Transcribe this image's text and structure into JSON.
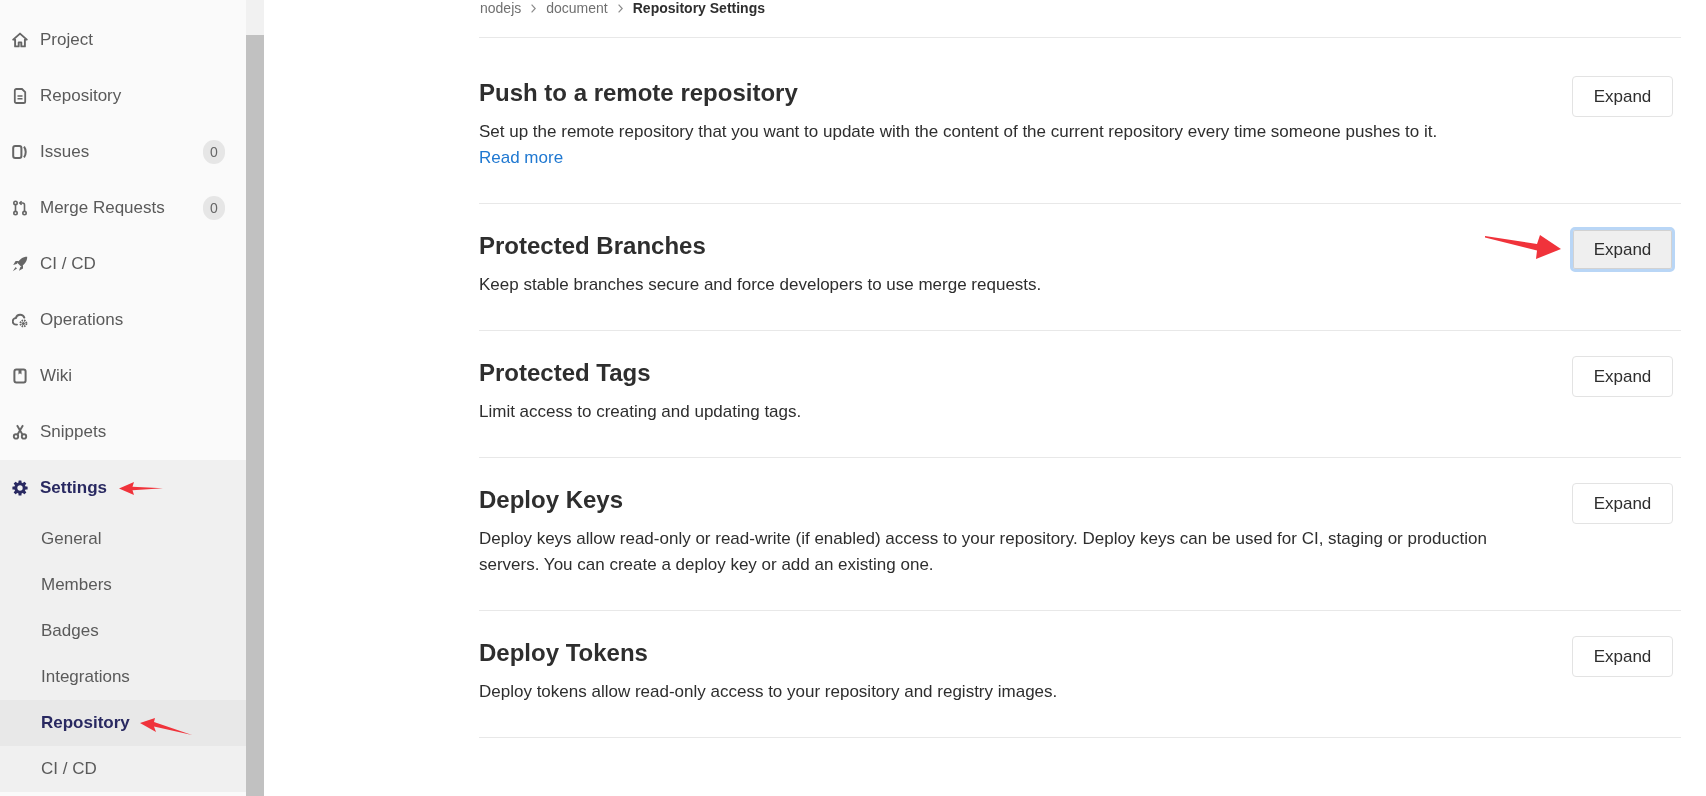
{
  "breadcrumb": [
    "nodejs",
    "document",
    "Repository Settings"
  ],
  "sidebar": {
    "items": [
      {
        "label": "Project",
        "selected": false,
        "annotation_arrow": false
      },
      {
        "label": "Repository",
        "selected": false,
        "annotation_arrow": false
      },
      {
        "label": "Issues",
        "count": "0",
        "selected": false,
        "annotation_arrow": false
      },
      {
        "label": "Merge Requests",
        "count": "0",
        "selected": false,
        "annotation_arrow": false
      },
      {
        "label": "CI / CD",
        "selected": false,
        "annotation_arrow": false
      },
      {
        "label": "Operations",
        "selected": false,
        "annotation_arrow": false
      },
      {
        "label": "Wiki",
        "selected": false,
        "annotation_arrow": false
      },
      {
        "label": "Snippets",
        "selected": false,
        "annotation_arrow": false
      },
      {
        "label": "Settings",
        "selected": true,
        "annotation_arrow": true,
        "children": [
          {
            "label": "General",
            "selected": false,
            "annotation_arrow": false
          },
          {
            "label": "Members",
            "selected": false,
            "annotation_arrow": false
          },
          {
            "label": "Badges",
            "selected": false,
            "annotation_arrow": false
          },
          {
            "label": "Integrations",
            "selected": false,
            "annotation_arrow": false
          },
          {
            "label": "Repository",
            "selected": true,
            "annotation_arrow": true
          },
          {
            "label": "CI / CD",
            "selected": false,
            "annotation_arrow": false
          }
        ]
      }
    ]
  },
  "sections": [
    {
      "title": "Push to a remote repository",
      "description": "Set up the remote repository that you want to update with the content of the current repository every time someone pushes to it.",
      "link": "Read more",
      "button": {
        "label": "Expand",
        "focused": false,
        "annotation_arrow": false
      }
    },
    {
      "title": "Protected Branches",
      "description": "Keep stable branches secure and force developers to use merge requests.",
      "button": {
        "label": "Expand",
        "focused": true,
        "annotation_arrow": true
      }
    },
    {
      "title": "Protected Tags",
      "description": "Limit access to creating and updating tags.",
      "button": {
        "label": "Expand",
        "focused": false,
        "annotation_arrow": false
      }
    },
    {
      "title": "Deploy Keys",
      "description": "Deploy keys allow read-only or read-write (if enabled) access to your repository. Deploy keys can be used for CI, staging or production servers. You can create a deploy key or add an existing one.",
      "button": {
        "label": "Expand",
        "focused": false,
        "annotation_arrow": false
      }
    },
    {
      "title": "Deploy Tokens",
      "description": "Deploy tokens allow read-only access to your repository and registry images.",
      "button": {
        "label": "Expand",
        "focused": false,
        "annotation_arrow": false
      }
    }
  ]
}
